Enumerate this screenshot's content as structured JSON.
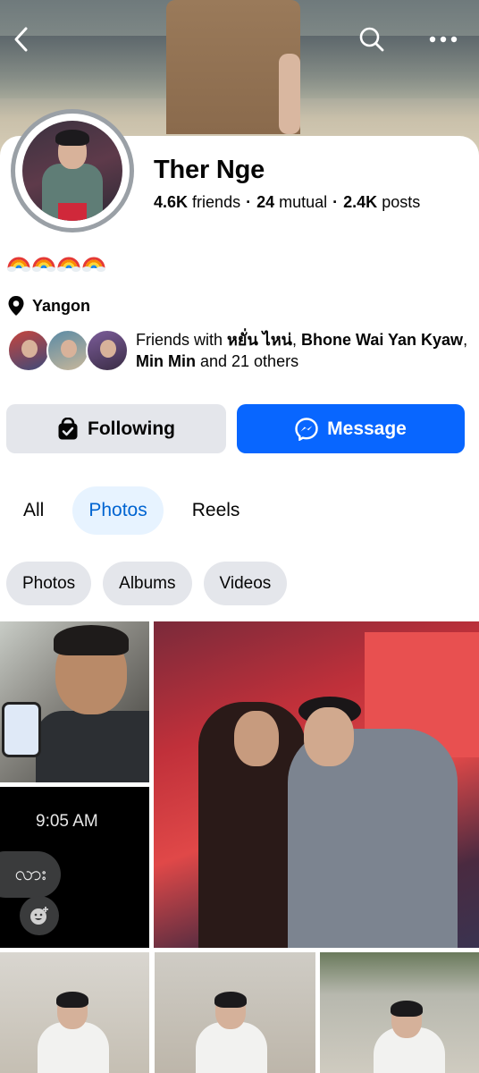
{
  "profile": {
    "name": "Ther Nge",
    "stats": {
      "friends_count": "4.6K",
      "friends_label": "friends",
      "mutual_count": "24",
      "mutual_label": "mutual",
      "posts_count": "2.4K",
      "posts_label": "posts",
      "separator": "·"
    },
    "bio_emojis": [
      "rainbow",
      "rainbow",
      "rainbow",
      "rainbow"
    ],
    "location": "Yangon",
    "friends_with": {
      "prefix": "Friends with ",
      "name1": "หยั่น ไหน่",
      "sep1": ", ",
      "name2": "Bhone Wai Yan Kyaw",
      "sep2": ", ",
      "name3": "Min Min",
      "suffix": " and 21 others"
    }
  },
  "actions": {
    "following_label": "Following",
    "message_label": "Message"
  },
  "tabs": [
    {
      "label": "All",
      "active": false
    },
    {
      "label": "Photos",
      "active": true
    },
    {
      "label": "Reels",
      "active": false
    }
  ],
  "chips": [
    "Photos",
    "Albums",
    "Videos"
  ],
  "photos": {
    "screenshot_time": "9:05 AM",
    "screenshot_bubble_text": "လား"
  },
  "colors": {
    "accent": "#0866ff",
    "active_tab_bg": "#e7f3ff",
    "active_tab_text": "#0064d1",
    "chip_bg": "#e4e6eb"
  },
  "icons": {
    "back": "chevron-left-icon",
    "search": "search-icon",
    "more": "more-horizontal-icon",
    "location": "map-pin-icon",
    "following": "following-icon",
    "message": "messenger-icon"
  }
}
